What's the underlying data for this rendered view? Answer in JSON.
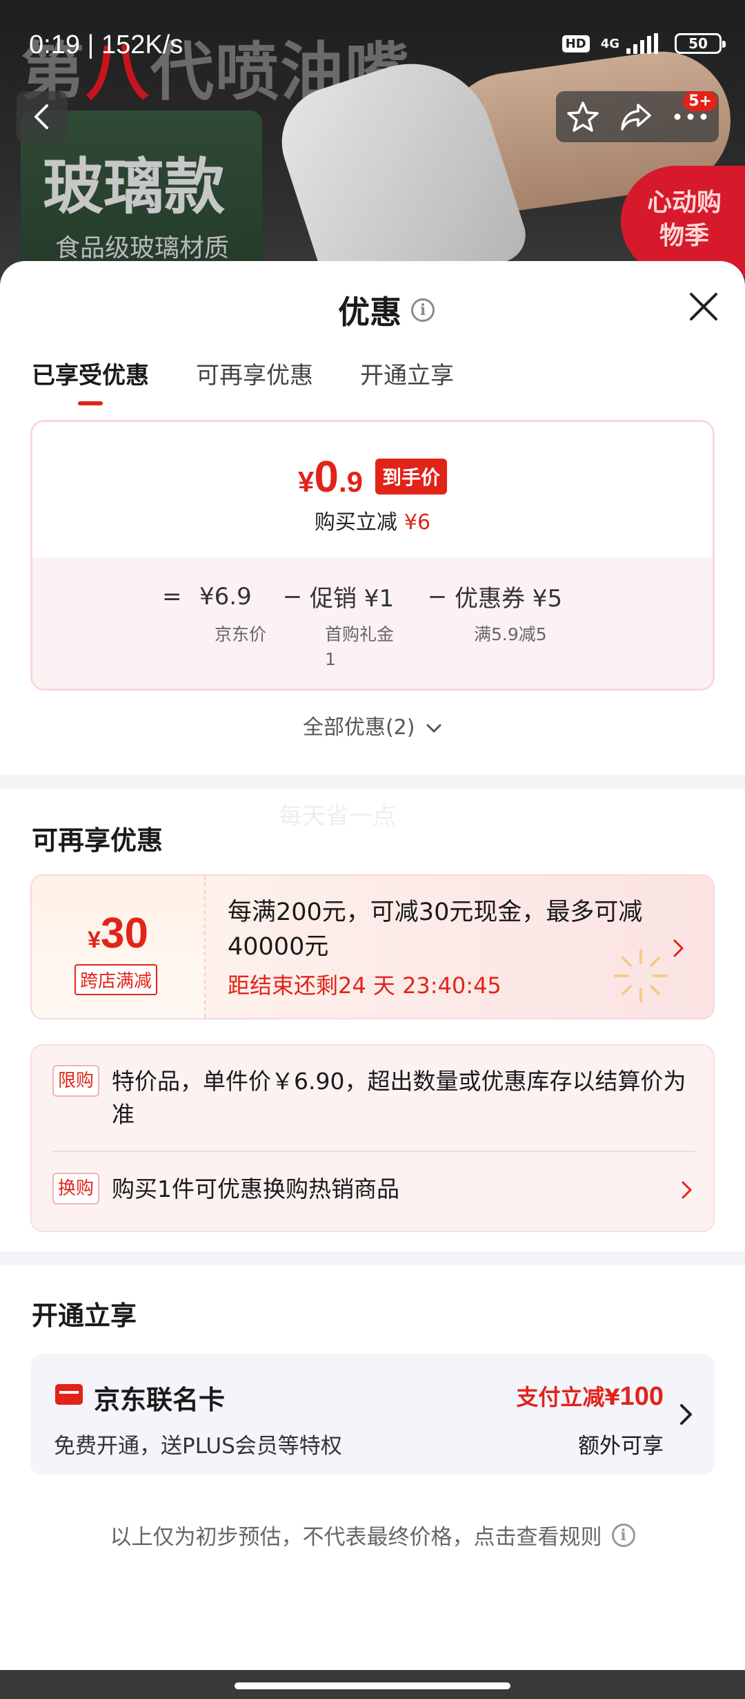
{
  "status_bar": {
    "time_speed": "0:19 | 152K/s",
    "hd": "HD",
    "network": "4G",
    "battery": "50"
  },
  "hero": {
    "headline_part1": "第",
    "headline_red": "八",
    "headline_part2": "代喷油嘴",
    "glass_title": "玻璃款",
    "glass_sub": "食品级玻璃材质",
    "promo_badge": "心动购物季",
    "message_count": "5+"
  },
  "sheet": {
    "title": "优惠",
    "tabs": [
      "已享受优惠",
      "可再享优惠",
      "开通立享"
    ],
    "active_tab": 0,
    "price_card": {
      "currency": "¥",
      "price_int": "0",
      "price_dec": ".9",
      "price_tag": "到手价",
      "discount_label": "购买立减",
      "discount_amount": "¥6",
      "eq": "=",
      "original_price": "¥6.9",
      "minus1": "−",
      "promo_label": "促销 ¥1",
      "minus2": "−",
      "coupon_label": "优惠券 ¥5",
      "original_sub": "京东价",
      "promo_sub": "首购礼金\n1",
      "coupon_sub": "满5.9减5"
    },
    "all_offers": "全部优惠(2)",
    "watermark": "每天省一点",
    "more_offers": {
      "title": "可再享优惠",
      "coupon_currency": "¥",
      "coupon_amount": "30",
      "coupon_type": "跨店满减",
      "coupon_desc": "每满200元，可减30元现金，最多可减40000元",
      "countdown": "距结束还剩24 天 23:40:45"
    },
    "limits": [
      {
        "tag": "限购",
        "text": "特价品，单件价￥6.90，超出数量或优惠库存以结算价为准"
      },
      {
        "tag": "换购",
        "text": "购买1件可优惠换购热销商品"
      }
    ],
    "open_section": {
      "title": "开通立享",
      "card_name": "京东联名卡",
      "card_sub": "免费开通，送PLUS会员等特权",
      "benefit_prefix": "支付立减¥",
      "benefit_amount": "100",
      "benefit_extra": "额外可享"
    },
    "footnote": "以上仅为初步预估，不代表最终价格，点击查看规则"
  },
  "colors": {
    "accent": "#e2231a",
    "divider": "#f2f4f8"
  },
  "icons": [
    "back-icon",
    "star-icon",
    "share-icon",
    "more-icon",
    "close-icon",
    "info-icon",
    "chevron-down-icon",
    "chevron-right-icon",
    "card-icon"
  ]
}
